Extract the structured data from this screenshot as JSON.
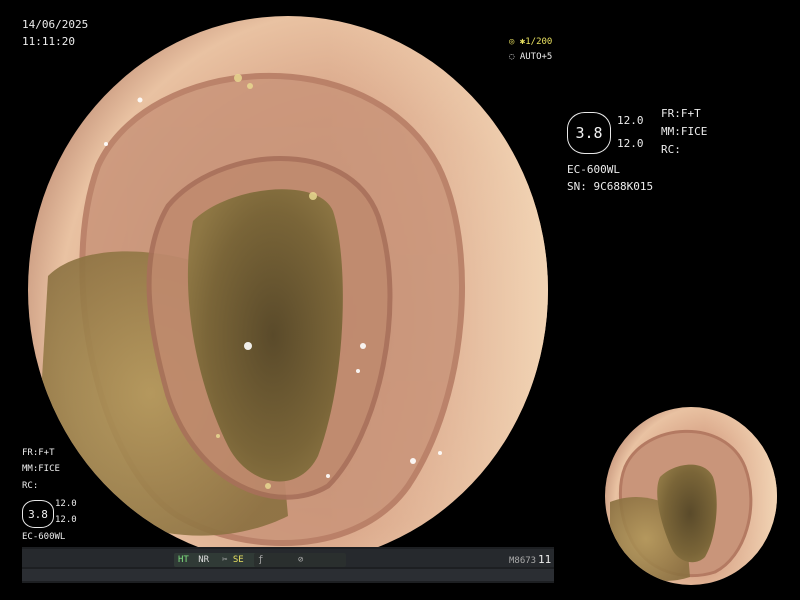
{
  "overlay_top_left": {
    "date": "14/06/2025",
    "time": "11:11:20"
  },
  "overlay_top_mid": {
    "shutter": "✱1/200",
    "shutter_icon": "settings-dot-icon",
    "auto": "AUTO+5",
    "auto_icon": "auto-adjust-icon"
  },
  "overlay_right": {
    "hex_value": "3.8",
    "val1": "12.0",
    "val2": "12.0",
    "fr": "FR:F+T",
    "mm": "MM:FICE",
    "rc": "RC:",
    "scope_model": "EC-600WL",
    "serial": "SN: 9C688K015"
  },
  "overlay_bottom_left": {
    "fr": "FR:F+T",
    "mm": "MM:FICE",
    "rc": "RC:",
    "hex_value": "3.8",
    "val1": "12.0",
    "val2": "12.0",
    "scope_model": "EC-600WL"
  },
  "status_bar": {
    "ht": "HT",
    "nr": "NR",
    "se_icon": "scissors-icon",
    "se": "SE",
    "f_icon": "slash-icon",
    "circle_icon": "circle-mode-icon",
    "code": "M8673",
    "count": "11"
  },
  "colors": {
    "background": "#000000",
    "mucosa": "#d8a68c",
    "fluid": "#9a8245",
    "accent": "#7fe07f"
  }
}
